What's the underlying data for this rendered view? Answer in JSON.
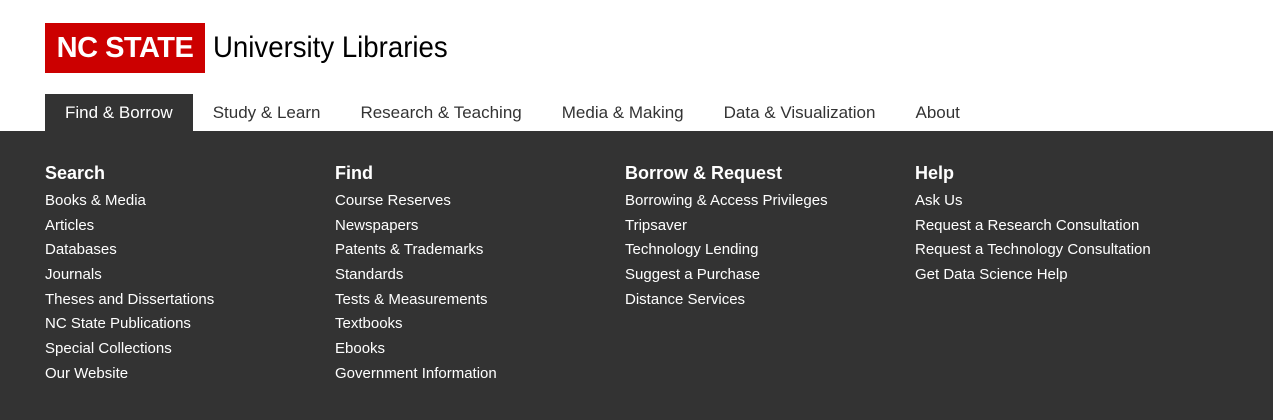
{
  "logo": {
    "brand": "NC STATE",
    "subtitle": "University Libraries",
    "brand_color": "#cc0000"
  },
  "nav": {
    "items": [
      {
        "label": "Find & Borrow",
        "active": true
      },
      {
        "label": "Study & Learn",
        "active": false
      },
      {
        "label": "Research & Teaching",
        "active": false
      },
      {
        "label": "Media & Making",
        "active": false
      },
      {
        "label": "Data & Visualization",
        "active": false
      },
      {
        "label": "About",
        "active": false
      }
    ]
  },
  "menu": {
    "background": "#333333",
    "columns": [
      {
        "heading": "Search",
        "links": [
          "Books & Media",
          "Articles",
          "Databases",
          "Journals",
          "Theses and Dissertations",
          "NC State Publications",
          "Special Collections",
          "Our Website"
        ]
      },
      {
        "heading": "Find",
        "links": [
          "Course Reserves",
          "Newspapers",
          "Patents & Trademarks",
          "Standards",
          "Tests & Measurements",
          "Textbooks",
          "Ebooks",
          "Government Information"
        ]
      },
      {
        "heading": "Borrow & Request",
        "links": [
          "Borrowing & Access Privileges",
          "Tripsaver",
          "Technology Lending",
          "Suggest a Purchase",
          "Distance Services"
        ]
      },
      {
        "heading": "Help",
        "links": [
          "Ask Us",
          "Request a Research Consultation",
          "Request a Technology Consultation",
          "Get Data Science Help"
        ]
      }
    ]
  }
}
